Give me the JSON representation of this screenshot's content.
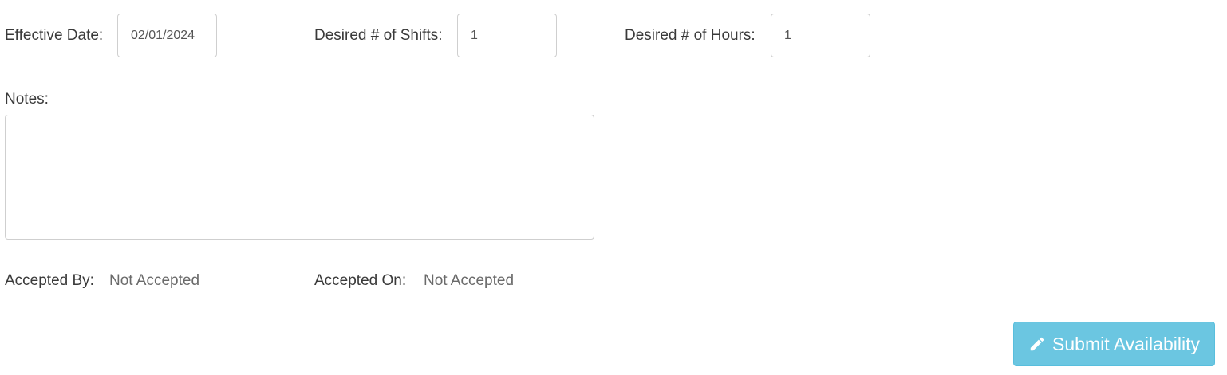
{
  "form": {
    "effective_date_label": "Effective Date:",
    "effective_date_value": "02/01/2024",
    "desired_shifts_label": "Desired # of Shifts:",
    "desired_shifts_value": "1",
    "desired_hours_label": "Desired # of Hours:",
    "desired_hours_value": "1",
    "notes_label": "Notes:",
    "notes_value": "",
    "accepted_by_label": "Accepted By:",
    "accepted_by_value": "Not Accepted",
    "accepted_on_label": "Accepted On:",
    "accepted_on_value": "Not Accepted"
  },
  "actions": {
    "submit_label": "Submit Availability",
    "submit_icon": "pencil-icon",
    "submit_color": "#5bc0de"
  }
}
